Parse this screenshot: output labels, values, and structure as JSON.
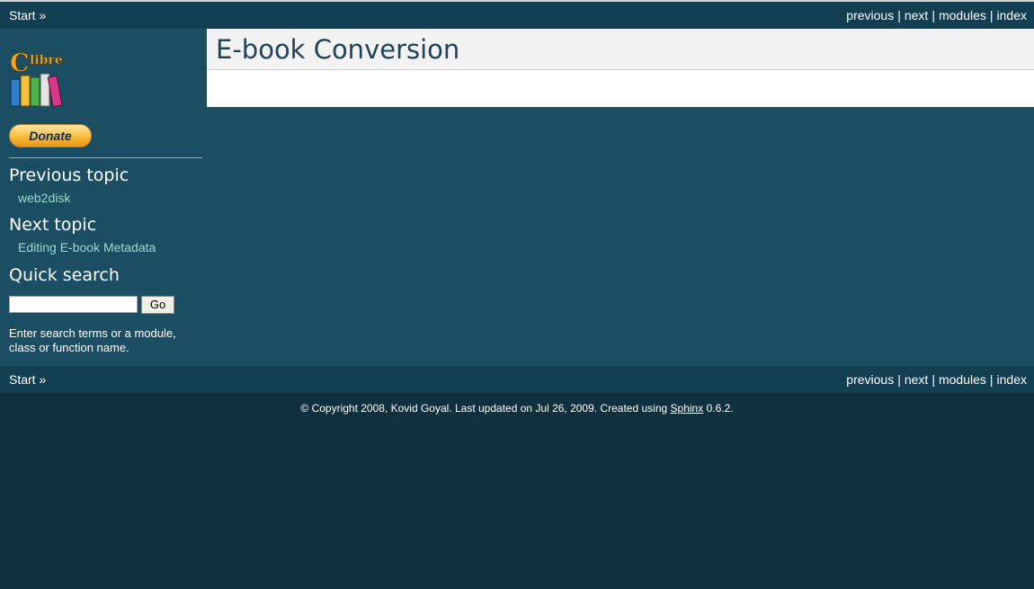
{
  "nav": {
    "start": "Start »",
    "previous": "previous",
    "next": "next",
    "modules": "modules",
    "index": "index",
    "separator": "|"
  },
  "sidebar": {
    "logo_icon": "calibre-books-logo",
    "donate_label": "Donate",
    "previous_topic_heading": "Previous topic",
    "previous_topic_link": "web2disk",
    "next_topic_heading": "Next topic",
    "next_topic_link": "Editing E-book Metadata",
    "quick_search_heading": "Quick search",
    "search_value": "",
    "go_label": "Go",
    "search_hint": "Enter search terms or a module, class or function name."
  },
  "main": {
    "title": "E-book Conversion"
  },
  "footer": {
    "prefix": "© Copyright 2008, Kovid Goyal. Last updated on Jul 26, 2009. Created using",
    "sphinx_link": "Sphinx",
    "suffix": "0.6.2."
  },
  "colors": {
    "relbar_bg": "#133f52",
    "document_bg": "#1c4e63",
    "page_bg": "#11303d",
    "link": "#98dbcc",
    "title": "#20435c"
  }
}
